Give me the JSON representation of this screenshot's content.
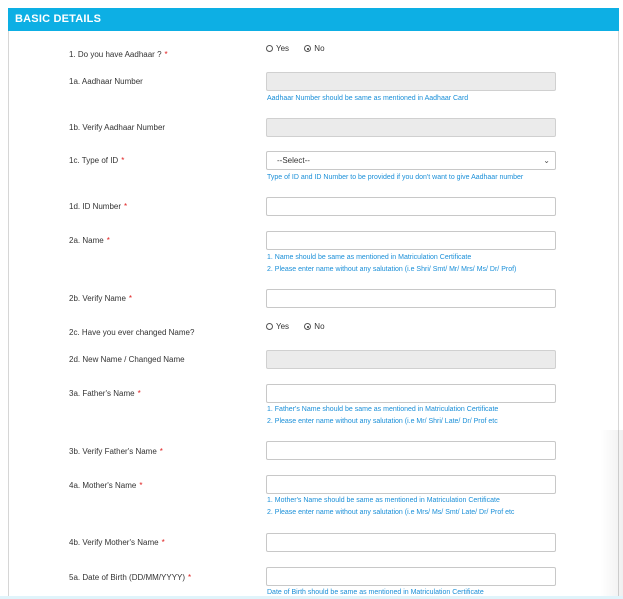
{
  "header": {
    "title": "BASIC DETAILS"
  },
  "q1": {
    "label": "1. Do you have Aadhaar ?",
    "yes": "Yes",
    "no": "No",
    "selected": "No"
  },
  "q1a": {
    "label": "1a. Aadhaar Number",
    "value": "",
    "hint": "Aadhaar Number should be same as mentioned in Aadhaar Card"
  },
  "q1b": {
    "label": "1b. Verify Aadhaar Number",
    "value": ""
  },
  "q1c": {
    "label": "1c. Type of ID",
    "selected": "--Select--",
    "hint": "Type of ID and ID Number to be provided if you don't want to give Aadhaar number"
  },
  "q1d": {
    "label": "1d. ID Number",
    "value": ""
  },
  "q2a": {
    "label": "2a. Name",
    "hint1": "1. Name should be same as mentioned in Matriculation Certificate",
    "hint2": "2. Please enter name without any salutation (i.e Shri/ Smt/ Mr/ Mrs/ Ms/ Dr/ Prof)"
  },
  "q2b": {
    "label": "2b. Verify Name"
  },
  "q2c": {
    "label": "2c. Have you ever changed Name?",
    "yes": "Yes",
    "no": "No",
    "selected": "No"
  },
  "q2d": {
    "label": "2d. New Name / Changed Name"
  },
  "q3a": {
    "label": "3a. Father's Name",
    "hint1": "1. Father's Name should be same as mentioned in Matriculation Certificate",
    "hint2": "2. Please enter name without any salutation (i.e Mr/ Shri/ Late/ Dr/ Prof etc"
  },
  "q3b": {
    "label": "3b. Verify Father's Name"
  },
  "q4a": {
    "label": "4a. Mother's Name",
    "hint1": "1. Mother's Name should be same as mentioned in Matriculation Certificate",
    "hint2": "2. Please enter name without any salutation (i.e Mrs/ Ms/ Smt/ Late/ Dr/ Prof etc"
  },
  "q4b": {
    "label": "4b. Verify Mother's Name"
  },
  "q5a": {
    "label": "5a. Date of Birth (DD/MM/YYYY)",
    "hint": "Date of Birth should be same as mentioned in Matriculation Certificate"
  },
  "required_marker": "*",
  "colors": {
    "header": "#0dafe4",
    "hint": "#1a8fd8",
    "required": "#e02020"
  }
}
